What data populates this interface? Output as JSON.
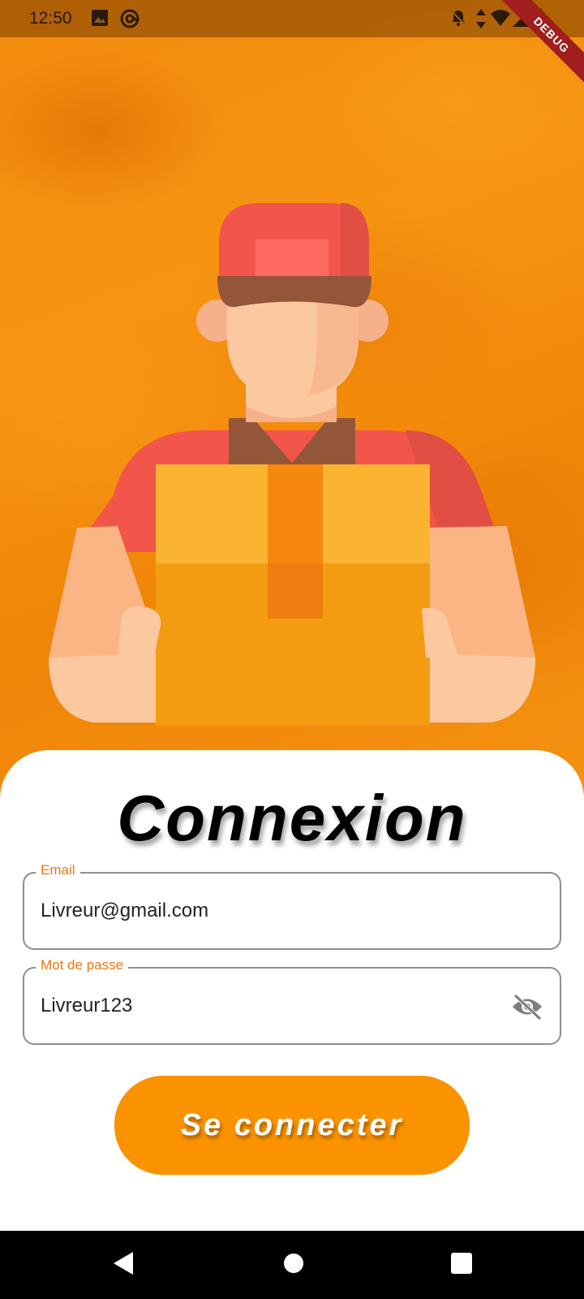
{
  "status_bar": {
    "time": "12:50",
    "left_icons": [
      "image-icon",
      "at-sign-icon"
    ],
    "right_icons": [
      "notifications-off-icon",
      "data-arrows-icon",
      "wifi-icon",
      "signal-icon",
      "battery-icon"
    ],
    "debug_label": "DEBUG"
  },
  "login": {
    "title": "Connexion",
    "email": {
      "label": "Email",
      "value": "Livreur@gmail.com"
    },
    "password": {
      "label": "Mot de passe",
      "value": "Livreur123",
      "toggle_icon": "visibility-off-icon"
    },
    "submit_label": "Se connecter"
  },
  "navigation_bar": {
    "buttons": [
      "back-icon",
      "home-icon",
      "recents-icon"
    ]
  },
  "colors": {
    "accent": "#fb9200",
    "label": "#e6790b",
    "card": "#ffffff"
  }
}
